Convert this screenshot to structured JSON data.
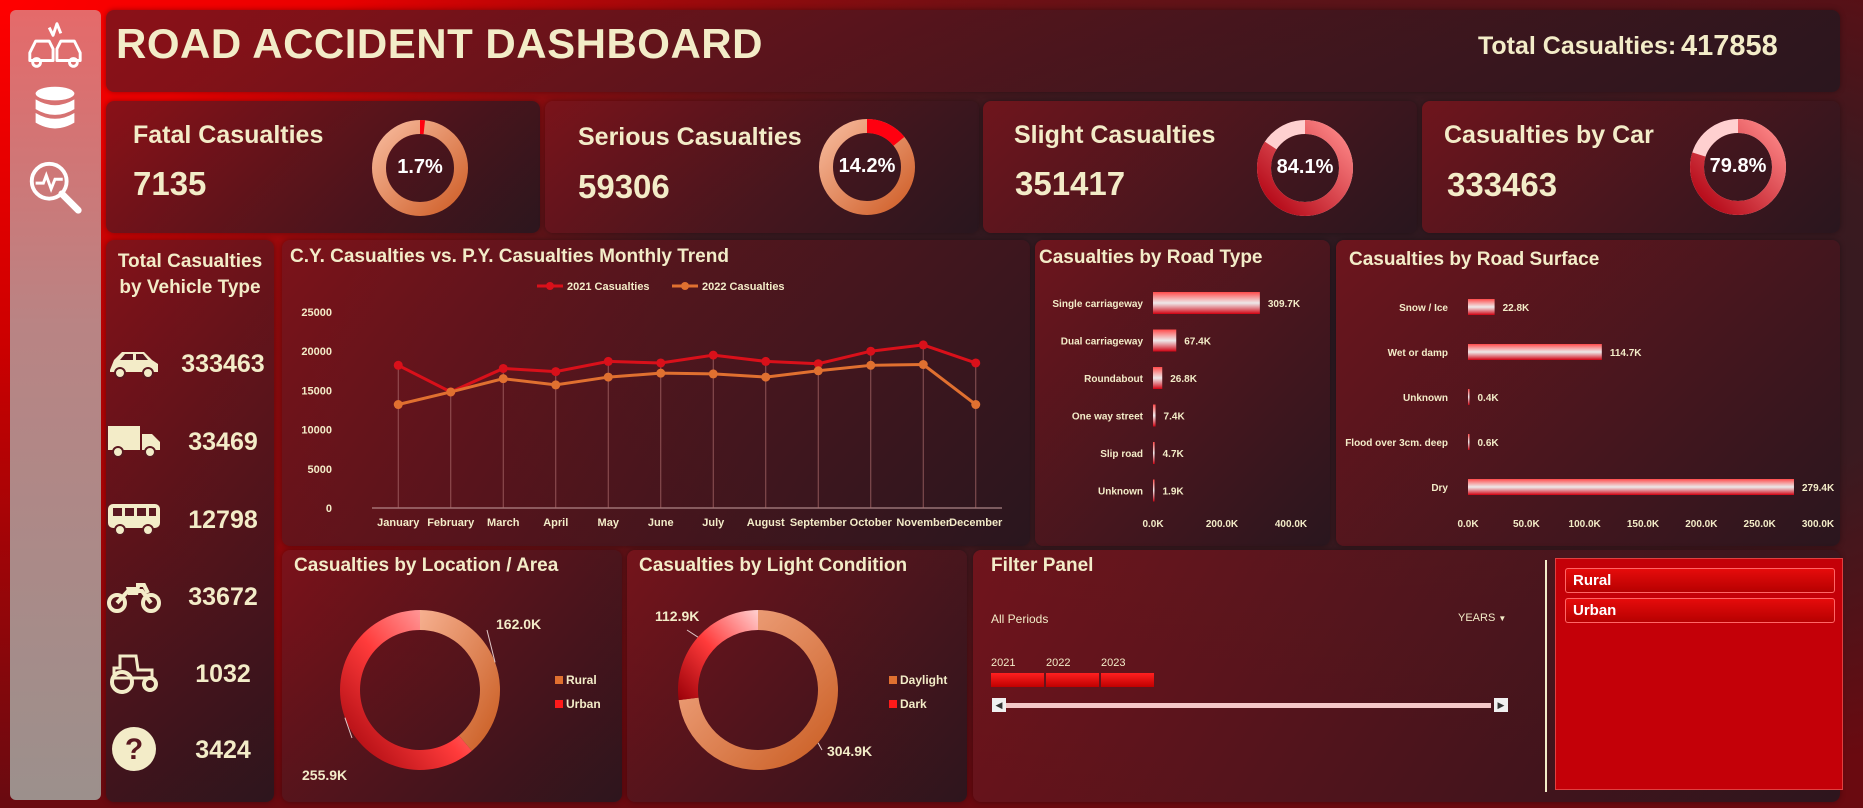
{
  "header": {
    "title": "ROAD ACCIDENT DASHBOARD",
    "total_label": "Total Casualties:",
    "total_value": "417858"
  },
  "sidebar": {
    "icons": [
      "car-crash-icon",
      "database-icon",
      "search-analytics-icon"
    ]
  },
  "kpis": [
    {
      "label": "Fatal Casualties",
      "value": "7135",
      "percent": "1.7%",
      "fraction": 0.017
    },
    {
      "label": "Serious Casualties",
      "value": "59306",
      "percent": "14.2%",
      "fraction": 0.142
    },
    {
      "label": "Slight Casualties",
      "value": "351417",
      "percent": "84.1%",
      "fraction": 0.841
    },
    {
      "label": "Casualties by Car",
      "value": "333463",
      "percent": "79.8%",
      "fraction": 0.798
    }
  ],
  "vehicles": {
    "title_line1": "Total Casualties",
    "title_line2": "by Vehicle Type",
    "items": [
      {
        "icon": "car-icon",
        "value": "333463"
      },
      {
        "icon": "truck-icon",
        "value": "33469"
      },
      {
        "icon": "bus-icon",
        "value": "12798"
      },
      {
        "icon": "motorcycle-icon",
        "value": "33672"
      },
      {
        "icon": "tractor-icon",
        "value": "1032"
      },
      {
        "icon": "question-icon",
        "value": "3424"
      }
    ]
  },
  "trend": {
    "title": "C.Y. Casualties vs. P.Y. Casualties Monthly Trend"
  },
  "road_type": {
    "title": "Casualties by Road Type"
  },
  "road_surface": {
    "title": "Casualties by Road Surface"
  },
  "location": {
    "title": "Casualties by Location / Area"
  },
  "light": {
    "title": "Casualties by Light Condition"
  },
  "filter": {
    "title": "Filter Panel",
    "period_label": "All Periods",
    "years_label": "YEARS",
    "years": [
      "2021",
      "2022",
      "2023"
    ],
    "slicer_items": [
      "Rural",
      "Urban"
    ]
  },
  "colors": {
    "accent": "#ff0000",
    "cy_line": "#d9101a",
    "py_line": "#e07030",
    "text": "#f3ecc8"
  },
  "chart_data": [
    {
      "type": "line",
      "title": "C.Y. Casualties vs. P.Y. Casualties Monthly Trend",
      "categories": [
        "January",
        "February",
        "March",
        "April",
        "May",
        "June",
        "July",
        "August",
        "September",
        "October",
        "November",
        "December"
      ],
      "series": [
        {
          "name": "2021 Casualties",
          "values": [
            18200,
            14800,
            17800,
            17400,
            18700,
            18500,
            19500,
            18700,
            18400,
            20000,
            20800,
            18500
          ]
        },
        {
          "name": "2022 Casualties",
          "values": [
            13200,
            14800,
            16500,
            15700,
            16700,
            17200,
            17100,
            16700,
            17500,
            18200,
            18300,
            13200
          ]
        }
      ],
      "yticks": [
        "0",
        "5000",
        "10000",
        "15000",
        "20000",
        "25000"
      ],
      "ylim": [
        0,
        25000
      ],
      "legend": "top"
    },
    {
      "type": "bar",
      "orientation": "horizontal",
      "title": "Casualties by Road Type",
      "categories": [
        "Single carriageway",
        "Dual carriageway",
        "Roundabout",
        "One way street",
        "Slip road",
        "Unknown"
      ],
      "values": [
        309.7,
        67.4,
        26.8,
        7.4,
        4.7,
        1.9
      ],
      "labels": [
        "309.7K",
        "67.4K",
        "26.8K",
        "7.4K",
        "4.7K",
        "1.9K"
      ],
      "xticks": [
        "0.0K",
        "200.0K",
        "400.0K"
      ],
      "xlim": [
        0,
        400
      ]
    },
    {
      "type": "bar",
      "orientation": "horizontal",
      "title": "Casualties by Road Surface",
      "categories": [
        "Snow / Ice",
        "Wet or damp",
        "Unknown",
        "Flood over 3cm. deep",
        "Dry"
      ],
      "values": [
        22.8,
        114.7,
        0.4,
        0.6,
        279.4
      ],
      "labels": [
        "22.8K",
        "114.7K",
        "0.4K",
        "0.6K",
        "279.4K"
      ],
      "xticks": [
        "0.0K",
        "50.0K",
        "100.0K",
        "150.0K",
        "200.0K",
        "250.0K",
        "300.0K"
      ],
      "xlim": [
        0,
        300
      ]
    },
    {
      "type": "pie",
      "donut": true,
      "title": "Casualties by Location / Area",
      "categories": [
        "Rural",
        "Urban"
      ],
      "values": [
        162.0,
        255.9
      ],
      "labels": [
        "162.0K",
        "255.9K"
      ]
    },
    {
      "type": "pie",
      "donut": true,
      "title": "Casualties by Light Condition",
      "categories": [
        "Daylight",
        "Dark"
      ],
      "values": [
        304.9,
        112.9
      ],
      "labels": [
        "304.9K",
        "112.9K"
      ]
    }
  ]
}
